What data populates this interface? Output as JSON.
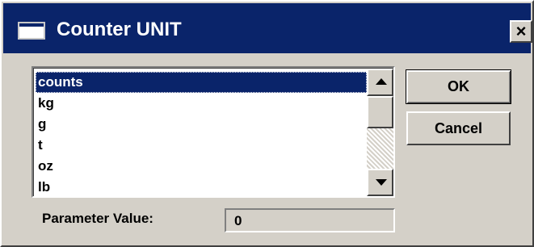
{
  "window": {
    "title": "Counter UNIT",
    "close_label": "×"
  },
  "listbox": {
    "items": [
      "counts",
      "kg",
      "g",
      "t",
      "oz",
      "lb"
    ],
    "selected": "counts"
  },
  "buttons": {
    "ok_label": "OK",
    "cancel_label": "Cancel"
  },
  "parameter": {
    "label": "Parameter Value:",
    "value": "0"
  },
  "colors": {
    "titlebar": "#0a246a",
    "face": "#d4d0c8",
    "selection": "#0a246a"
  },
  "icons": {
    "window_icon": "window-icon",
    "scroll_up": "arrow-up-icon",
    "scroll_down": "arrow-down-icon",
    "close": "close-icon"
  }
}
